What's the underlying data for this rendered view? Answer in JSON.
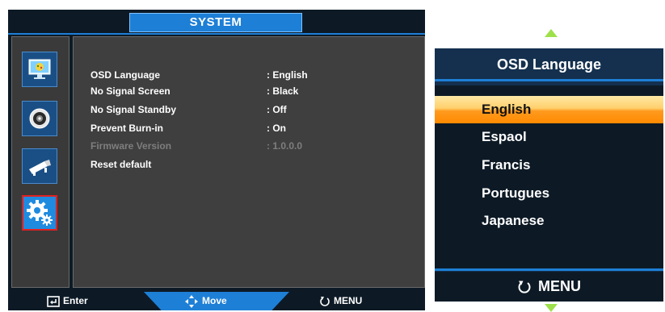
{
  "system_menu": {
    "title": "SYSTEM",
    "sidebar": [
      {
        "name": "picture-icon"
      },
      {
        "name": "audio-icon"
      },
      {
        "name": "projector-icon"
      },
      {
        "name": "system-gear-icon",
        "selected": true
      }
    ],
    "rows": [
      {
        "label": "OSD Language",
        "value": ": English",
        "enabled": true
      },
      {
        "label": "No Signal Screen",
        "value": ": Black",
        "enabled": true
      },
      {
        "label": "No Signal Standby",
        "value": ": Off",
        "enabled": true
      },
      {
        "label": "Prevent Burn-in",
        "value": ": On",
        "enabled": true
      },
      {
        "label": "Firmware Version",
        "value": ": 1.0.0.0",
        "enabled": false
      },
      {
        "label": "Reset default",
        "value": "",
        "enabled": true
      }
    ],
    "hints": {
      "enter": "Enter",
      "move": "Move",
      "menu": "MENU"
    }
  },
  "language_menu": {
    "title": "OSD Language",
    "items": [
      "English",
      "Espaol",
      "Francis",
      "Portugues",
      "Japanese"
    ],
    "selected_index": 0,
    "footer": "MENU"
  },
  "colors": {
    "accent_blue": "#1e7fd6",
    "selection_orange": "#ff8a00",
    "scroll_arrow_green": "#9ee04a"
  }
}
